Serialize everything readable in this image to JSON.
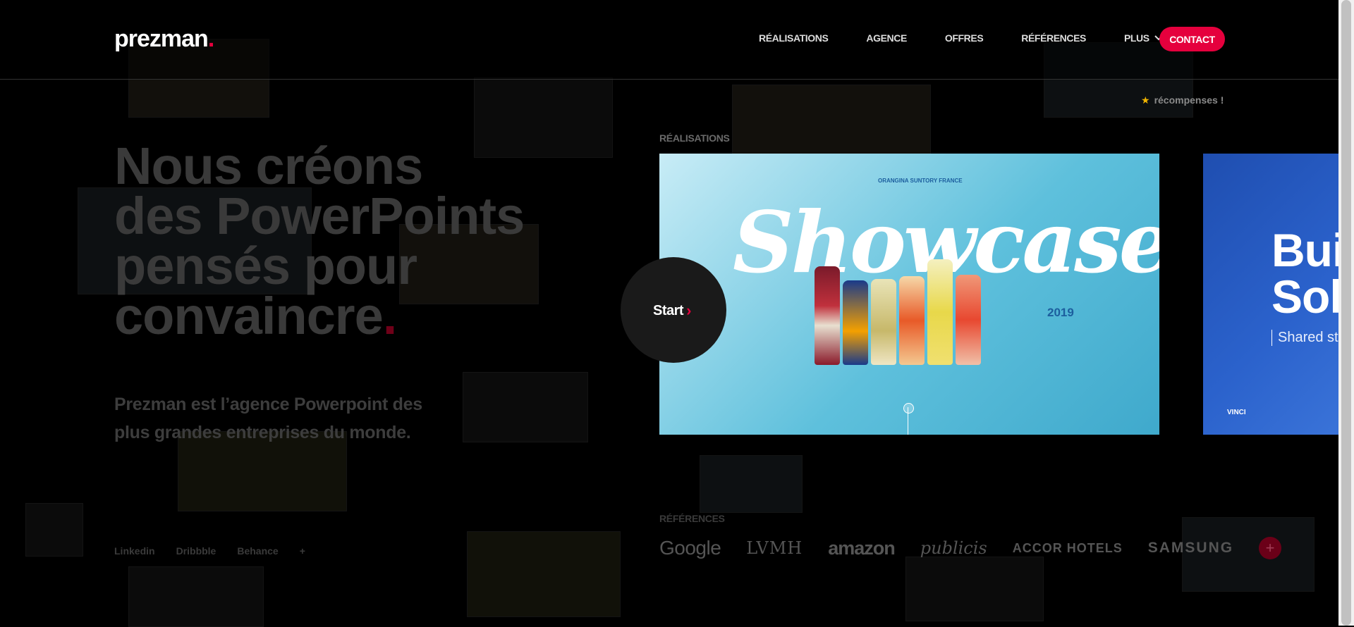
{
  "header": {
    "logo_text": "prezman",
    "logo_dot": ".",
    "nav": [
      {
        "label": "RÉALISATIONS"
      },
      {
        "label": "AGENCE"
      },
      {
        "label": "OFFRES"
      },
      {
        "label": "RÉFÉRENCES"
      },
      {
        "label": "PLUS"
      }
    ],
    "contact_label": "CONTACT"
  },
  "awards": {
    "label": "récompenses !",
    "icon": "star-icon"
  },
  "hero": {
    "title_lines": [
      "Nous créons",
      "des PowerPoints",
      "pensés pour",
      "convaincre"
    ],
    "title_dot": ".",
    "subtitle": "Prezman est l’agence Powerpoint des plus grandes entreprises du monde."
  },
  "social": {
    "links": [
      "Linkedin",
      "Dribbble",
      "Behance",
      "+"
    ]
  },
  "realisations": {
    "label": "RÉALISATIONS",
    "start_label": "Start",
    "slide1": {
      "brand": "ORANGINA SUNTORY FRANCE",
      "title": "Showcase",
      "year": "2019"
    },
    "slide2": {
      "title_line1": "Bui",
      "title_line2": "Sol",
      "subtitle": "Shared st",
      "brand": "VINCI"
    }
  },
  "references": {
    "label": "RÉFÉRENCES",
    "logos": [
      "Google",
      "LVMH",
      "amazon",
      "publicis",
      "ACCOR HOTELS",
      "SAMSUNG"
    ],
    "more_label": "+"
  },
  "colors": {
    "accent": "#e5003d",
    "background": "#000000"
  }
}
